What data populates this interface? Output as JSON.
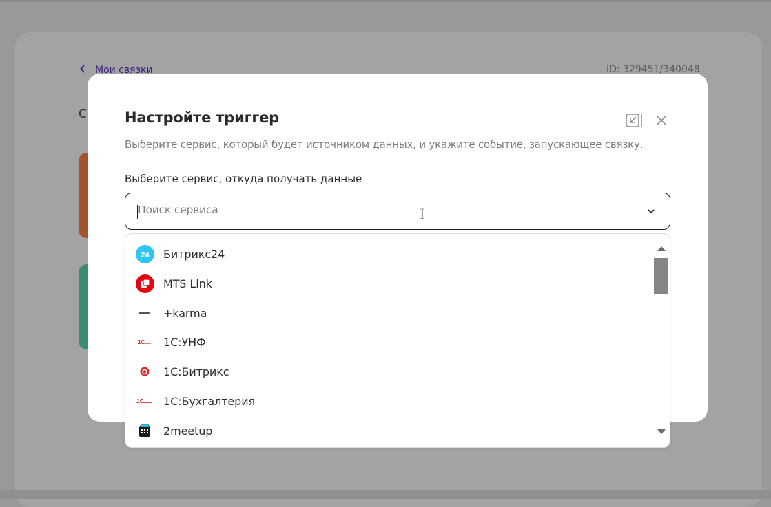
{
  "page": {
    "back_link": "Мои связки",
    "id_text": "ID: 329451/340048",
    "heading_fragment": "С"
  },
  "modal": {
    "title": "Настройте триггер",
    "subtitle": "Выберите сервис, который будет источником данных, и укажите событие, запускающее связку.",
    "field_label": "Выберите сервис, откуда получать данные",
    "search_placeholder": "Поиск сервиса",
    "services": [
      {
        "label": "Битрикс24",
        "icon": "bitrix24-icon"
      },
      {
        "label": "MTS Link",
        "icon": "mts-link-icon"
      },
      {
        "label": "+karma",
        "icon": "karma-icon"
      },
      {
        "label": "1С:УНФ",
        "icon": "1c-unf-icon"
      },
      {
        "label": "1С:Битрикс",
        "icon": "1c-bitrix-icon"
      },
      {
        "label": "1С:Бухгалтерия",
        "icon": "1c-accounting-icon"
      },
      {
        "label": "2meetup",
        "icon": "2meetup-icon"
      }
    ]
  },
  "colors": {
    "overlay": "#999999",
    "accent_link": "#3d1e7c",
    "bitrix_blue": "#2fc6f6",
    "mts_red": "#e30611",
    "onec_red": "#d32f2f"
  }
}
